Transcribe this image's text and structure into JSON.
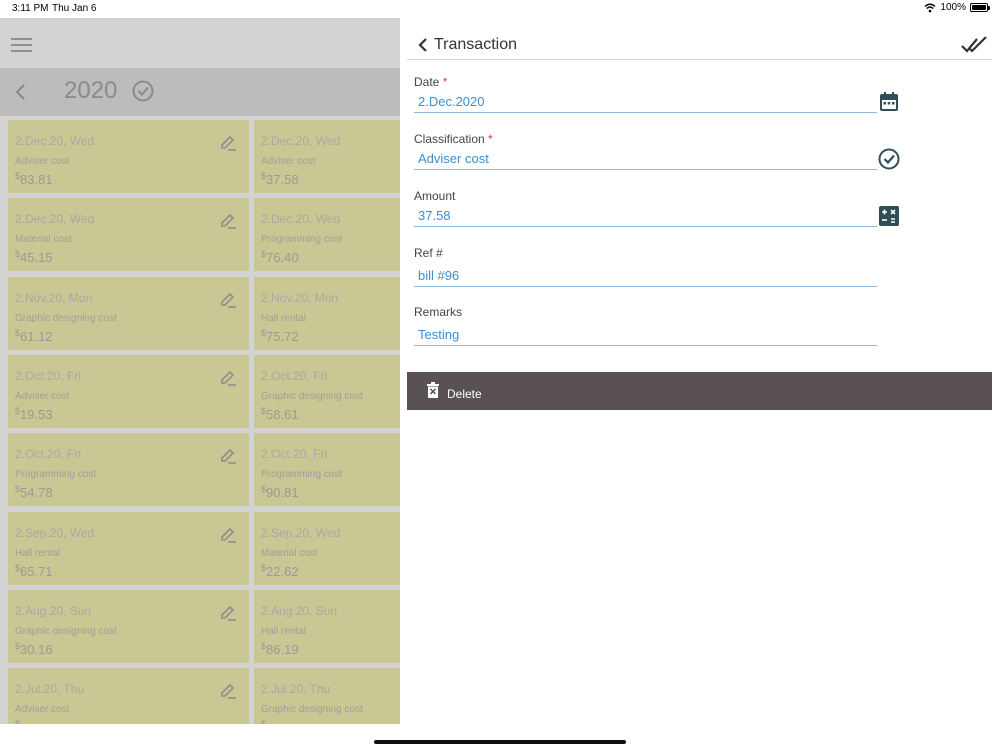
{
  "status_bar": {
    "time": "3:11 PM",
    "date": "Thu Jan 6",
    "battery": "100%",
    "battery_level": 1.0
  },
  "list": {
    "year": "2020",
    "currency_symbol": "$",
    "rows": [
      {
        "left": {
          "date": "2.Dec.20, Wed",
          "category": "Adviser cost",
          "amount": "83.81"
        },
        "right": {
          "date": "2.Dec.20, Wed",
          "category": "Adviser cost",
          "amount": "37.58"
        }
      },
      {
        "left": {
          "date": "2.Dec.20, Wed",
          "category": "Material cost",
          "amount": "45.15"
        },
        "right": {
          "date": "2.Dec.20, Wed",
          "category": "Programming cost",
          "amount": "76.40"
        }
      },
      {
        "left": {
          "date": "2.Nov.20, Mon",
          "category": "Graphic designing cost",
          "amount": "61.12"
        },
        "right": {
          "date": "2.Nov.20, Mon",
          "category": "Hall rental",
          "amount": "75.72"
        }
      },
      {
        "left": {
          "date": "2.Oct.20, Fri",
          "category": "Adviser cost",
          "amount": "19.53"
        },
        "right": {
          "date": "2.Oct.20, Fri",
          "category": "Graphic designing cost",
          "amount": "58.61"
        }
      },
      {
        "left": {
          "date": "2.Oct.20, Fri",
          "category": "Programming cost",
          "amount": "54.78"
        },
        "right": {
          "date": "2.Oct.20, Fri",
          "category": "Programming cost",
          "amount": "90.81"
        }
      },
      {
        "left": {
          "date": "2.Sep.20, Wed",
          "category": "Hall rental",
          "amount": "65.71"
        },
        "right": {
          "date": "2.Sep.20, Wed",
          "category": "Material cost",
          "amount": "22.62"
        }
      },
      {
        "left": {
          "date": "2.Aug.20, Sun",
          "category": "Graphic designing cost",
          "amount": "30.16"
        },
        "right": {
          "date": "2.Aug.20, Sun",
          "category": "Hall rental",
          "amount": "86.19"
        }
      },
      {
        "left": {
          "date": "2.Jul.20, Thu",
          "category": "Adviser cost",
          "amount": ""
        },
        "right": {
          "date": "2.Jul.20, Thu",
          "category": "Graphic designing cost",
          "amount": ""
        }
      }
    ]
  },
  "detail": {
    "title": "Transaction",
    "required_mark": "*",
    "fields": {
      "date": {
        "label": "Date",
        "value": "2.Dec.2020"
      },
      "classification": {
        "label": "Classification",
        "value": "Adviser cost"
      },
      "amount": {
        "label": "Amount",
        "value": "37.58"
      },
      "ref": {
        "label": "Ref #",
        "value": "bill #96"
      },
      "remarks": {
        "label": "Remarks",
        "value": "Testing"
      }
    },
    "delete_label": "Delete"
  },
  "icons": {
    "menu": "hamburger-menu-icon",
    "back": "chevron-left-icon",
    "year_check": "check-circle-icon",
    "edit": "pencil-icon",
    "done": "double-check-icon",
    "calendar": "calendar-icon",
    "classification": "check-circle-icon",
    "calculator": "calculator-icon",
    "delete": "trash-icon"
  },
  "colors": {
    "card_bg": "#c9c793",
    "field_value": "#3a8fd0",
    "required": "#e53935",
    "delete_bg": "#5a5156",
    "icon_dark": "#2f4f55"
  }
}
